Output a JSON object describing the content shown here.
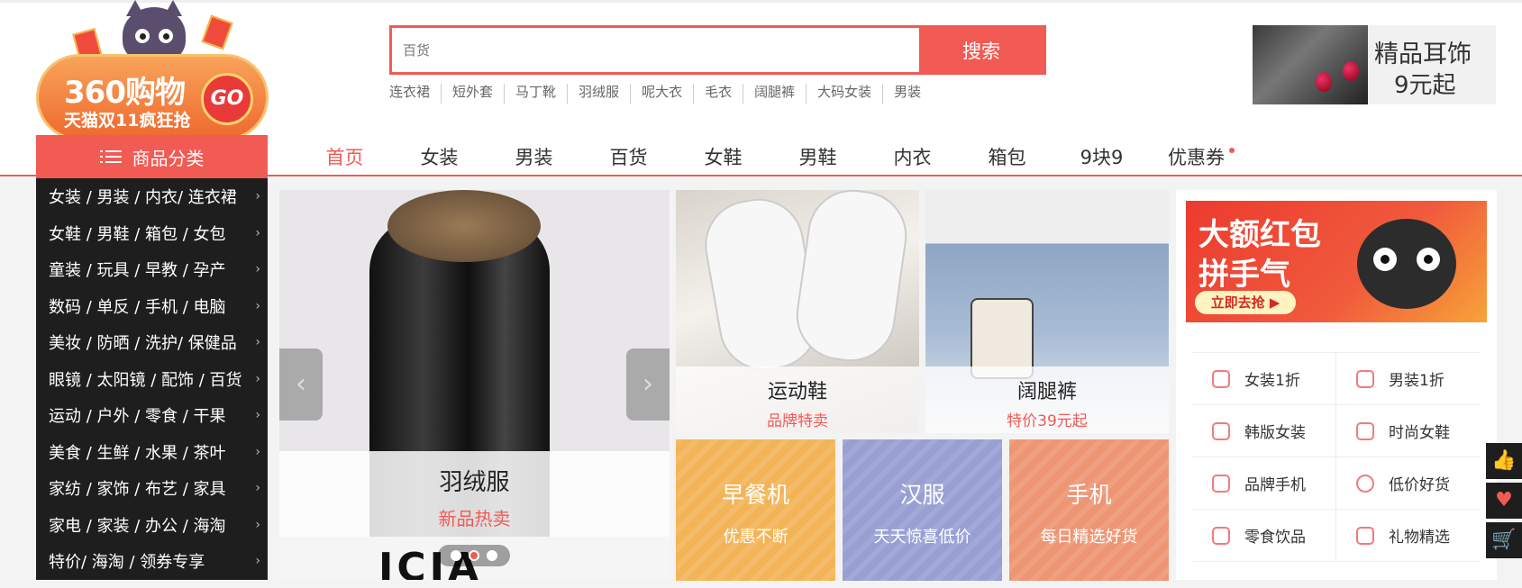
{
  "logo": {
    "line1": "360购物",
    "line2": "天猫双11疯狂抢",
    "go": "GO"
  },
  "search": {
    "placeholder": "百货",
    "button": "搜索"
  },
  "hotwords": [
    "连衣裙",
    "短外套",
    "马丁靴",
    "羽绒服",
    "呢大衣",
    "毛衣",
    "阔腿裤",
    "大码女装",
    "男装"
  ],
  "top_ad": {
    "line1": "精品耳饰",
    "line2": "9元起"
  },
  "category_header": "商品分类",
  "nav": [
    {
      "label": "首页",
      "active": true
    },
    {
      "label": "女装"
    },
    {
      "label": "男装"
    },
    {
      "label": "百货"
    },
    {
      "label": "女鞋"
    },
    {
      "label": "男鞋"
    },
    {
      "label": "内衣"
    },
    {
      "label": "箱包"
    },
    {
      "label": "9块9"
    },
    {
      "label": "优惠券",
      "dot": true
    }
  ],
  "side_menu": [
    "女装 / 男装 / 内衣/ 连衣裙",
    "女鞋 / 男鞋 / 箱包 / 女包",
    "童装 / 玩具 / 早教 / 孕产",
    "数码 / 单反 / 手机 / 电脑",
    "美妆 / 防晒 / 洗护/ 保健品",
    "眼镜 / 太阳镜 / 配饰 / 百货",
    "运动 / 户外 / 零食 / 干果",
    "美食 / 生鲜 / 水果 / 茶叶",
    "家纺 / 家饰 / 布艺 / 家具",
    "家电 / 家装 / 办公 / 海淘",
    "特价/ 海淘 / 领券专享"
  ],
  "banner": {
    "title": "羽绒服",
    "subtitle": "新品热卖",
    "bottom_text": "ICIA",
    "slides": 3,
    "active_slide": 2
  },
  "tiles": [
    {
      "title": "运动鞋",
      "subtitle": "品牌特卖"
    },
    {
      "title": "阔腿裤",
      "subtitle": "特价39元起"
    }
  ],
  "color_tiles": [
    {
      "title": "早餐机",
      "subtitle": "优惠不断",
      "color": "#f3b457"
    },
    {
      "title": "汉服",
      "subtitle": "天天惊喜低价",
      "color": "#979fd3"
    },
    {
      "title": "手机",
      "subtitle": "每日精选好货",
      "color": "#ee9573"
    }
  ],
  "red_packet": {
    "line1": "大额红包",
    "line2": "拼手气",
    "button": "立即去抢 ▶"
  },
  "quick_links": [
    {
      "label": "女装1折",
      "icon": "dress-icon"
    },
    {
      "label": "男装1折",
      "icon": "shirt-icon"
    },
    {
      "label": "韩版女装",
      "icon": "hat-icon"
    },
    {
      "label": "时尚女鞋",
      "icon": "heel-icon"
    },
    {
      "label": "品牌手机",
      "icon": "phone-icon"
    },
    {
      "label": "低价好货",
      "icon": "clock-icon"
    },
    {
      "label": "零食饮品",
      "icon": "snack-icon"
    },
    {
      "label": "礼物精选",
      "icon": "gift-icon"
    }
  ],
  "fixbar": [
    "thumbs-up-icon",
    "heart-icon",
    "cart-icon"
  ],
  "colors": {
    "accent": "#f25a54",
    "dark": "#1e1e1e"
  }
}
